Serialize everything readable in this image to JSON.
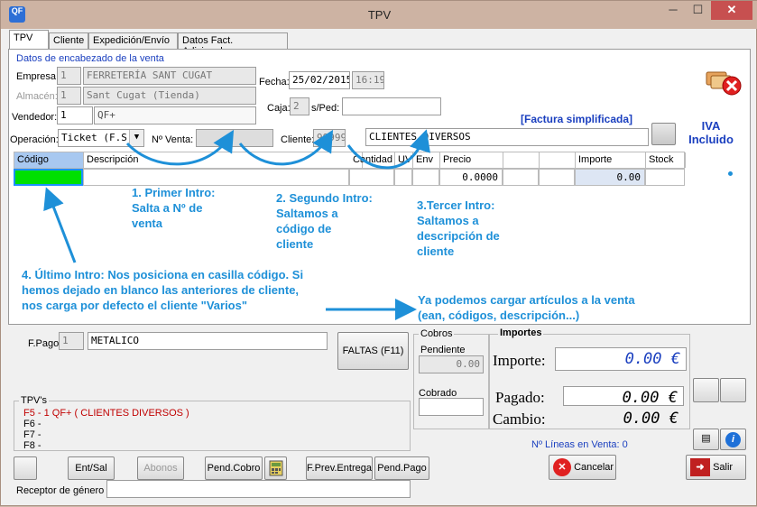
{
  "window": {
    "title": "TPV",
    "icon_text": "QF",
    "min": "─",
    "max": "☐",
    "close": "✕"
  },
  "tabs": [
    "TPV",
    "Cliente",
    "Expedición/Envío",
    "Datos Fact. Adicionales"
  ],
  "header": {
    "section_title": "Datos de encabezado de la venta",
    "empresa_label": "Empresa:",
    "empresa_code": "1",
    "empresa_name": "FERRETERÍA SANT CUGAT",
    "almacen_label": "Almacén:",
    "almacen_code": "1",
    "almacen_name": "Sant Cugat (Tienda)",
    "vendedor_label": "Vendedor:",
    "vendedor_code": "1",
    "vendedor_name": "QF+",
    "fecha_label": "Fecha:",
    "fecha": "25/02/2015",
    "hora": "16:19",
    "caja_label": "Caja:",
    "caja": "2",
    "sped_label": "s/Ped:",
    "sped": "",
    "operacion_label": "Operación:",
    "operacion": "Ticket (F.S.)",
    "nventa_label": "Nº Venta:",
    "nventa": "",
    "cliente_label": "Cliente:",
    "cliente_code": "99999",
    "cliente_name": "CLIENTES DIVERSOS",
    "factura_tag": "[Factura simplificada]",
    "iva_label": "IVA\nIncluido"
  },
  "grid": {
    "columns": [
      "Código",
      "Descripción",
      "Cantidad",
      "UV",
      "Env",
      "Precio",
      "",
      "",
      "Importe",
      "Stock"
    ],
    "row": {
      "codigo": "",
      "precio": "0.0000",
      "importe": "0.00"
    }
  },
  "notes": {
    "n1": "1. Primer Intro:\n   Salta a Nº de\n   venta",
    "n2": "2. Segundo Intro:\n   Saltamos a\n   código de\n   cliente",
    "n3": "3.Tercer Intro:\n   Saltamos a\n   descripción de\n   cliente",
    "n4": "4. Último Intro: Nos posiciona en casilla código. Si\n    hemos dejado en blanco las anteriores de cliente,\n    nos carga por defecto el cliente \"Varios\"",
    "n5": "Ya podemos cargar artículos a la venta\n(ean, códigos, descripción...)"
  },
  "footer": {
    "fpago_label": "F.Pago",
    "fpago_code": "1",
    "fpago_name": "METALICO",
    "faltas_button": "FALTAS (F11)",
    "cobros_title": "Cobros",
    "pendiente_label": "Pendiente",
    "pendiente_value": "0.00",
    "cobrado_label": "Cobrado",
    "cobrado_value": "",
    "importes_title": "Importes",
    "importe_label": "Importe:",
    "importe_value": "0.00 €",
    "pagado_label": "Pagado:",
    "pagado_value": "0.00 €",
    "cambio_label": "Cambio:",
    "cambio_value": "0.00 €",
    "tpvs_title": "TPV's",
    "tpv_lines": [
      "F5 - 1 QF+ ( CLIENTES DIVERSOS )",
      "F6 -",
      "F7 -",
      "F8 -"
    ],
    "lineas_label": "Nº Líneas en Venta: 0",
    "receptor_label": "Receptor de género",
    "receptor_value": ""
  },
  "buttons": {
    "entsal": "Ent/Sal",
    "abonos": "Abonos",
    "pendcobro": "Pend.Cobro",
    "fprev": "F.Prev.Entrega",
    "pendpago": "Pend.Pago",
    "cancelar": "Cancelar",
    "salir": "Salir"
  },
  "colors": {
    "accent_blue": "#1e90d8",
    "iva_blue": "#1a3fbf",
    "code_cell_green": "#00e000",
    "tpv_red": "#c00000",
    "title_bar": "#cdb3a3"
  }
}
